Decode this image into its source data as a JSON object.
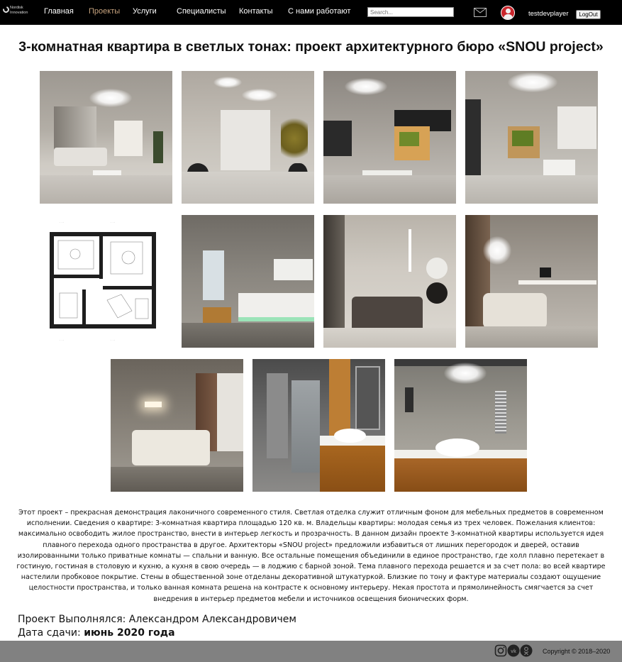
{
  "brand": {
    "line1": "Nordisk",
    "line2": "Innovation"
  },
  "nav": {
    "items": [
      {
        "label": "Главная"
      },
      {
        "label": "Проекты"
      },
      {
        "label": "Услуги"
      },
      {
        "label": "Специалисты"
      },
      {
        "label": "Контакты"
      },
      {
        "label": "С нами работают"
      }
    ],
    "active": "Проекты",
    "search_placeholder": "Search...",
    "mail_icon": "mail-icon",
    "username": "testdevplayer",
    "logout_label": "LogOut"
  },
  "project": {
    "title": "3-комнатная квартира в светлых тонах: проект архитектурного бюро «SNOU project»",
    "description": "Этот проект – прекрасная демонстрация лаконичного современного стиля. Светлая отделка служит отличным фоном для мебельных предметов в современном исполнении. Сведения о квартире: 3-комнатная квартира площадью 120 кв. м. Владельцы квартиры: молодая семья из трех человек. Пожелания клиентов: максимально освободить жилое пространство, внести в интерьер легкость и прозрачность. В данном дизайн проекте 3-комнатной квартиры используется идея плавного перехода одного пространства в другое. Архитекторы «SNOU project» предложили избавиться от лишних перегородок и дверей, оставив изолированными только приватные комнаты — спальни и ванную. Все остальные помещения объединили в единое пространство, где холл плавно перетекает в гостиную, гостиная в столовую и кухню, а кухня в свою очередь — в лоджию с барной зоной. Тема плавного перехода решается и за счет пола: во всей квартире настелили пробковое покрытие. Стены в общественной зоне отделаны декоративной штукатуркой. Близкие по тону и фактуре материалы создают ощущение целостности пространства, и только ванная комната решена на контрасте к основному интерьеру. Некая простота и прямолинейность смягчается за счет внедрения в интерьер предметов мебели и источников освещения бионических форм.",
    "credit": "Проект Выполнялся: Александром Александровичем",
    "date_label": "Дата сдачи:",
    "date_value": "июнь 2020 года"
  },
  "gallery": [
    {
      "scene": "living-room"
    },
    {
      "scene": "hallway"
    },
    {
      "scene": "living-room-tv"
    },
    {
      "scene": "living-room-wide"
    },
    {
      "scene": "floor-plan"
    },
    {
      "scene": "kitchen"
    },
    {
      "scene": "bedroom-dark"
    },
    {
      "scene": "bedroom-tv"
    },
    {
      "scene": "bedroom"
    },
    {
      "scene": "bathroom-shower"
    },
    {
      "scene": "bathroom-sink"
    }
  ],
  "footer": {
    "social": [
      "instagram-icon",
      "vk-icon",
      "odnoklassniki-icon"
    ],
    "copyright": "Copyright © 2018–2020"
  },
  "colors": {
    "nav_bg": "#000000",
    "nav_active": "#c8a47f",
    "footer_bg": "#818181",
    "avatar": "#c9252b"
  }
}
